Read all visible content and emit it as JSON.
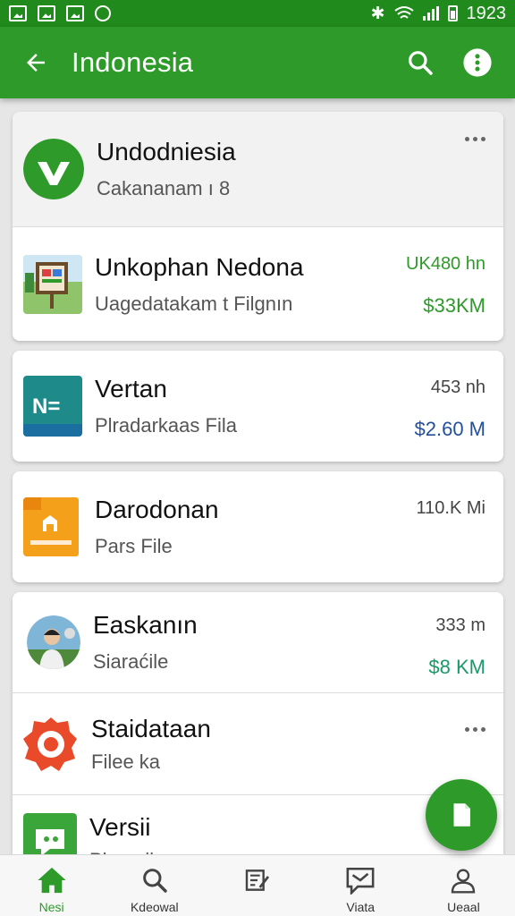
{
  "status_bar": {
    "time": "1923"
  },
  "app_bar": {
    "title": "Indonesia"
  },
  "header_card": {
    "title": "Undodniesia",
    "subtitle": "Cakananam ı 8"
  },
  "items": [
    {
      "title": "Unkophan Nedona",
      "subtitle": "Uagedatakam t Filgnın",
      "size": "UK480 hn",
      "price": "$33KM"
    },
    {
      "title": "Vertan",
      "subtitle": "Plradarkaas Fila",
      "size": "453 nh",
      "price": "$2.60 M"
    },
    {
      "title": "Darodonan",
      "subtitle": "Pars File",
      "size": "110.K Mi",
      "price": ""
    },
    {
      "title": "Easkanın",
      "subtitle": "Siaraćile",
      "size": "333 m",
      "price": "$8 KM"
    },
    {
      "title": "Staidataan",
      "subtitle": "Filee ka",
      "size": "",
      "price": ""
    },
    {
      "title": "Versii",
      "subtitle": "Pkeeaii",
      "size": "",
      "price": ""
    }
  ],
  "bottom_nav": [
    {
      "label": "Nesi"
    },
    {
      "label": "Kdeowal"
    },
    {
      "label": ""
    },
    {
      "label": "Viata"
    },
    {
      "label": "Ueaal"
    }
  ],
  "colors": {
    "primary": "#2e9a2a",
    "status_bar": "#218a1c",
    "accent_blue": "#234f9c"
  }
}
